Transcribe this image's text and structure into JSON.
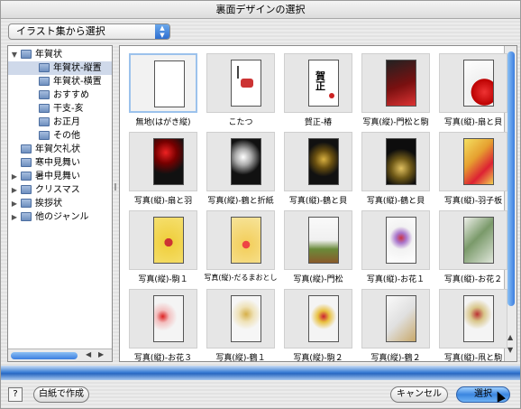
{
  "window": {
    "title": "裏面デザインの選択"
  },
  "source_select": {
    "value": "イラスト集から選択"
  },
  "tree": {
    "items": [
      {
        "label": "年賀状",
        "level": 0,
        "expanded": true,
        "selected": false
      },
      {
        "label": "年賀状-縦置",
        "level": 1,
        "expanded": false,
        "selected": true
      },
      {
        "label": "年賀状-横置",
        "level": 1,
        "expanded": false,
        "selected": false
      },
      {
        "label": "おすすめ",
        "level": 1,
        "expanded": false,
        "selected": false
      },
      {
        "label": "干支-亥",
        "level": 1,
        "expanded": false,
        "selected": false
      },
      {
        "label": "お正月",
        "level": 1,
        "expanded": false,
        "selected": false
      },
      {
        "label": "その他",
        "level": 1,
        "expanded": false,
        "selected": false
      },
      {
        "label": "年賀欠礼状",
        "level": 0,
        "expanded": null,
        "selected": false
      },
      {
        "label": "寒中見舞い",
        "level": 0,
        "expanded": null,
        "selected": false
      },
      {
        "label": "暑中見舞い",
        "level": 0,
        "expanded": false,
        "selected": false
      },
      {
        "label": "クリスマス",
        "level": 0,
        "expanded": false,
        "selected": false
      },
      {
        "label": "挨拶状",
        "level": 0,
        "expanded": false,
        "selected": false
      },
      {
        "label": "他のジャンル",
        "level": 0,
        "expanded": false,
        "selected": false
      }
    ]
  },
  "designs": {
    "items": [
      {
        "label": "無地(はがき縦)",
        "art": "blank",
        "selected": true
      },
      {
        "label": "こたつ",
        "art": "kotatsu"
      },
      {
        "label": "賀正-椿",
        "art": "gasho"
      },
      {
        "label": "写真(縦)-門松と駒",
        "art": "photo-red"
      },
      {
        "label": "写真(縦)-扇と貝",
        "art": "photo-fan"
      },
      {
        "label": "写真(縦)-扇と羽",
        "art": "photo-dark-red"
      },
      {
        "label": "写真(縦)-鶴と折紙",
        "art": "photo-dark-white"
      },
      {
        "label": "写真(縦)-鶴と貝",
        "art": "photo-dark-gold"
      },
      {
        "label": "写真(縦)-鶴と貝",
        "art": "photo-dark-gold2"
      },
      {
        "label": "写真(縦)-羽子板",
        "art": "photo-hagoita"
      },
      {
        "label": "写真(縦)-駒１",
        "art": "photo-yellow"
      },
      {
        "label": "写真(縦)-だるまおとし",
        "art": "photo-daruma",
        "small": true
      },
      {
        "label": "写真(縦)-門松",
        "art": "photo-kadomatsu"
      },
      {
        "label": "写真(縦)-お花１",
        "art": "photo-flower"
      },
      {
        "label": "写真(縦)-お花２",
        "art": "photo-pine"
      },
      {
        "label": "写真(縦)-お花３",
        "art": "photo-light-red"
      },
      {
        "label": "写真(縦)-鶴１",
        "art": "photo-light-gold"
      },
      {
        "label": "写真(縦)-駒２",
        "art": "photo-light-koma"
      },
      {
        "label": "写真(縦)-鶴２",
        "art": "photo-light-crane"
      },
      {
        "label": "写真(縦)-凧と駒",
        "art": "photo-light-kite"
      }
    ]
  },
  "buttons": {
    "help": "?",
    "blank": "白紙で作成",
    "cancel": "キャンセル",
    "select": "選択"
  },
  "colors": {
    "accent": "#3b86e0",
    "selection": "#cfd9ea"
  }
}
